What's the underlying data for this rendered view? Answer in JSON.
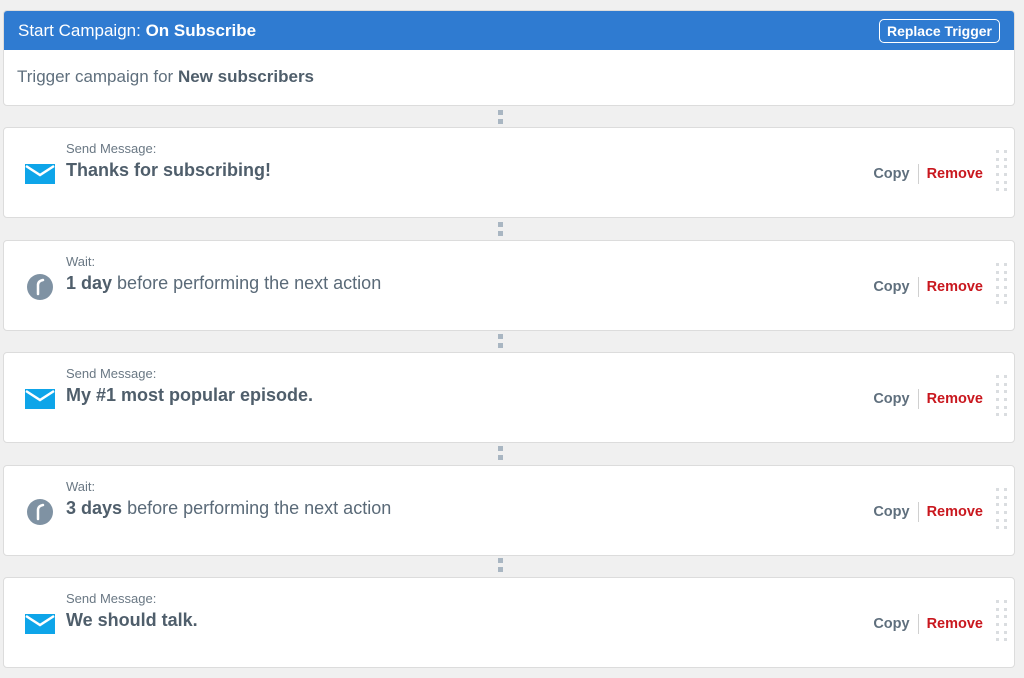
{
  "trigger": {
    "header_prefix": "Start Campaign:",
    "header_name": "On Subscribe",
    "replace_label": "Replace Trigger",
    "body_prefix": "Trigger campaign for",
    "body_target": "New subscribers",
    "header_color": "#2f7bd1"
  },
  "steps": [
    {
      "type": "send-message",
      "icon": "envelope-icon",
      "label": "Send Message:",
      "text": "Thanks for subscribing!",
      "copy": "Copy",
      "remove": "Remove"
    },
    {
      "type": "wait",
      "icon": "clock-icon",
      "label": "Wait:",
      "duration": "1 day",
      "text": "before performing the next action",
      "copy": "Copy",
      "remove": "Remove"
    },
    {
      "type": "send-message",
      "icon": "envelope-icon",
      "label": "Send Message:",
      "text": "My #1 most popular episode.",
      "copy": "Copy",
      "remove": "Remove"
    },
    {
      "type": "wait",
      "icon": "clock-icon",
      "label": "Wait:",
      "duration": "3 days",
      "text": "before performing the next action",
      "copy": "Copy",
      "remove": "Remove"
    },
    {
      "type": "send-message",
      "icon": "envelope-icon",
      "label": "Send Message:",
      "text": "We should talk.",
      "copy": "Copy",
      "remove": "Remove"
    }
  ],
  "colors": {
    "envelope": "#0ea5e9",
    "clock": "#7f92a3",
    "remove": "#c9171e"
  }
}
